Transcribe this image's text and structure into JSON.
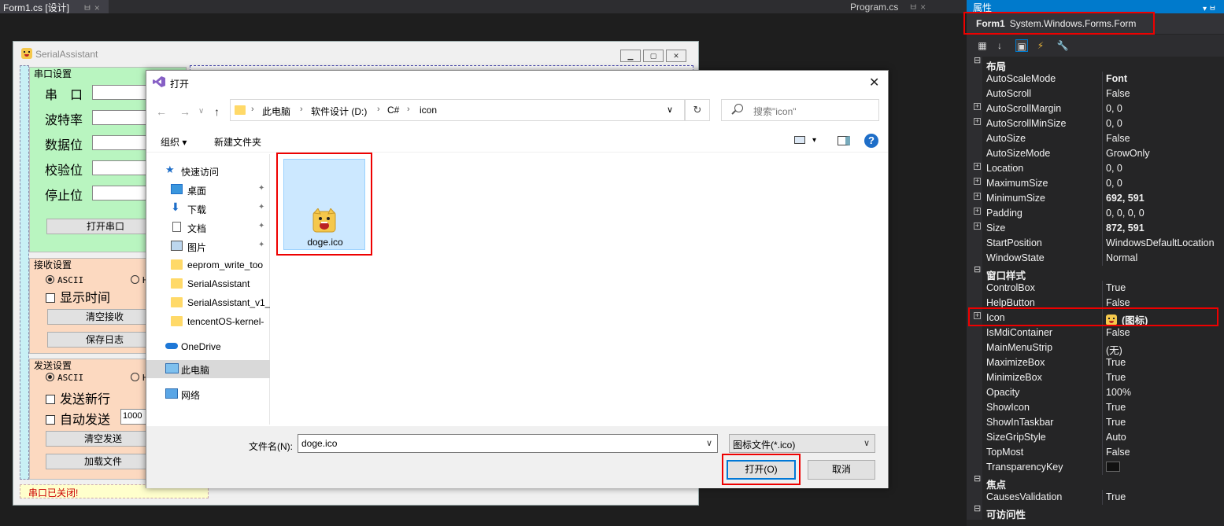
{
  "tabs": {
    "designer_tab": "Form1.cs [设计]",
    "designer_pin": "ㅂ ×",
    "program_tab": "Program.cs",
    "program_ctrl": "ㅂ ×"
  },
  "form": {
    "title": "SerialAssistant",
    "port_group": {
      "title": "串口设置",
      "labels": [
        "串　口",
        "波特率",
        "数据位",
        "校验位",
        "停止位"
      ],
      "open_button": "打开串口"
    },
    "receive_group": {
      "title": "接收设置",
      "radio_ascii": "ASCII",
      "radio_hex": "H",
      "show_time": "显示时间",
      "clear_button": "清空接收",
      "save_button": "保存日志"
    },
    "send_group": {
      "title": "发送设置",
      "radio_ascii": "ASCII",
      "radio_hex": "H",
      "newline": "发送新行",
      "auto_send": "自动发送",
      "interval_value": "1000",
      "clear_button": "清空发送",
      "load_button": "加载文件"
    },
    "status": "串口已关闭!"
  },
  "dialog": {
    "title": "打开",
    "close_glyph": "✕",
    "nav": {
      "back": "←",
      "forward": "→",
      "dropdown": "∨",
      "up": "↑"
    },
    "breadcrumbs": [
      "此电脑",
      "软件设计 (D:)",
      "C#",
      "icon"
    ],
    "breadcrumb_sep": "›",
    "address_dropdown": "∨",
    "refresh_glyph": "↻",
    "search_placeholder": "搜索\"icon\"",
    "toolbar": {
      "organize": "组织 ▾",
      "new_folder": "新建文件夹",
      "view_dropdown": "▾",
      "help": "?"
    },
    "nav_pane": {
      "quick_access": "快速访问",
      "items": [
        {
          "label": "桌面",
          "pinned": true
        },
        {
          "label": "下载",
          "pinned": true
        },
        {
          "label": "文档",
          "pinned": true
        },
        {
          "label": "图片",
          "pinned": true
        },
        {
          "label": "eeprom_write_too",
          "pinned": false
        },
        {
          "label": "SerialAssistant",
          "pinned": false
        },
        {
          "label": "SerialAssistant_v1_",
          "pinned": false
        },
        {
          "label": "tencentOS-kernel-",
          "pinned": false
        }
      ],
      "pin_glyph": "📌",
      "onedrive": "OneDrive",
      "this_pc": "此电脑",
      "network": "网络"
    },
    "file": {
      "name": "doge.ico"
    },
    "filename_label": "文件名(N):",
    "filename_value": "doge.ico",
    "filename_dropdown": "∨",
    "filter_value": "图标文件(*.ico)",
    "filter_dropdown": "∨",
    "open_button": "打开(O)",
    "cancel_button": "取消"
  },
  "properties": {
    "panel_title": "属性",
    "pin_glyph": "▾ ㅂ",
    "object_name": "Form1",
    "object_type": "System.Windows.Forms.Form",
    "toolbar_glyphs": [
      "▦",
      "↓",
      "▣",
      "⚡",
      "🔧"
    ],
    "rows": [
      {
        "kind": "cat",
        "name": "布局",
        "expander": "⊟"
      },
      {
        "name": "AutoScaleMode",
        "value": "Font",
        "bold": true
      },
      {
        "name": "AutoScroll",
        "value": "False"
      },
      {
        "name": "AutoScrollMargin",
        "value": "0, 0",
        "expander": "+"
      },
      {
        "name": "AutoScrollMinSize",
        "value": "0, 0",
        "expander": "+"
      },
      {
        "name": "AutoSize",
        "value": "False"
      },
      {
        "name": "AutoSizeMode",
        "value": "GrowOnly"
      },
      {
        "name": "Location",
        "value": "0, 0",
        "expander": "+"
      },
      {
        "name": "MaximumSize",
        "value": "0, 0",
        "expander": "+"
      },
      {
        "name": "MinimumSize",
        "value": "692, 591",
        "bold": true,
        "expander": "+"
      },
      {
        "name": "Padding",
        "value": "0, 0, 0, 0",
        "expander": "+"
      },
      {
        "name": "Size",
        "value": "872, 591",
        "bold": true,
        "expander": "+"
      },
      {
        "name": "StartPosition",
        "value": "WindowsDefaultLocation"
      },
      {
        "name": "WindowState",
        "value": "Normal"
      },
      {
        "kind": "cat",
        "name": "窗口样式",
        "expander": "⊟"
      },
      {
        "name": "ControlBox",
        "value": "True"
      },
      {
        "name": "HelpButton",
        "value": "False"
      },
      {
        "name": "Icon",
        "value": "(图标)",
        "bold": true,
        "expander": "+",
        "icon": true
      },
      {
        "name": "IsMdiContainer",
        "value": "False"
      },
      {
        "name": "MainMenuStrip",
        "value": "(无)"
      },
      {
        "name": "MaximizeBox",
        "value": "True"
      },
      {
        "name": "MinimizeBox",
        "value": "True"
      },
      {
        "name": "Opacity",
        "value": "100%"
      },
      {
        "name": "ShowIcon",
        "value": "True"
      },
      {
        "name": "ShowInTaskbar",
        "value": "True"
      },
      {
        "name": "SizeGripStyle",
        "value": "Auto"
      },
      {
        "name": "TopMost",
        "value": "False"
      },
      {
        "name": "TransparencyKey",
        "value": "",
        "swatch": true
      },
      {
        "kind": "cat",
        "name": "焦点",
        "expander": "⊟"
      },
      {
        "name": "CausesValidation",
        "value": "True"
      },
      {
        "kind": "cat",
        "name": "可访问性",
        "expander": "⊟"
      }
    ]
  },
  "colors": {
    "vs_dark": "#1e1e1e",
    "vs_accent": "#007acc",
    "highlight_red": "#e00000",
    "port_group_bg": "#b9f5c0",
    "recv_group_bg": "#fcd9c0",
    "textarea_bg": "#c8f0f5"
  }
}
